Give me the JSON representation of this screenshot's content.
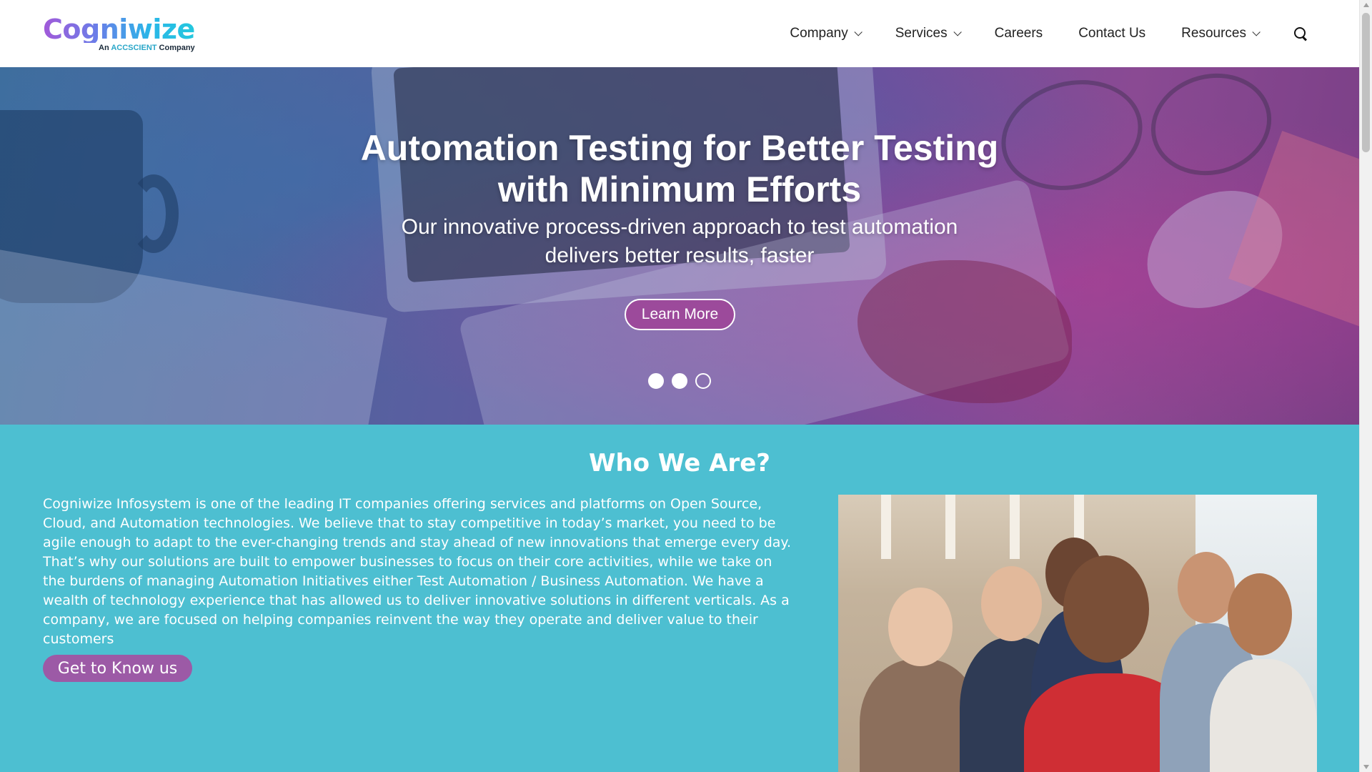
{
  "header": {
    "logo_text": "Cogniwize",
    "logo_tag_prefix": "An ",
    "logo_tag_brand": "ACCSCIENT",
    "logo_tag_suffix": " Company",
    "nav": [
      {
        "label": "Company",
        "dropdown": true
      },
      {
        "label": "Services",
        "dropdown": true
      },
      {
        "label": "Careers",
        "dropdown": false
      },
      {
        "label": "Contact Us",
        "dropdown": false
      },
      {
        "label": "Resources",
        "dropdown": true
      }
    ],
    "search_icon": "search-icon"
  },
  "hero": {
    "title_line1": "Automation Testing for Better Testing",
    "title_line2": "with Minimum Efforts",
    "subtitle_line1": "Our innovative process-driven approach to test automation",
    "subtitle_line2": "delivers better results, faster",
    "cta_label": "Learn More",
    "slides": [
      {
        "active": true
      },
      {
        "active": true
      },
      {
        "active": false
      }
    ]
  },
  "who": {
    "title": "Who We Are?",
    "body": "Cogniwize Infosystem is one of the leading IT companies offering services and platforms on Open Source, Cloud, and Automation technologies. We believe that to stay competitive in today’s market, you need to be agile enough to adapt to the ever-changing trends and stay ahead of new innovations that emerge every day. That’s why our solutions are built to empower businesses to focus on their core activities, while we take on the burdens of managing Automation Initiatives either Test Automation / Business Automation. We have a wealth of technology experience that has allowed us to deliver innovative solutions in different verticals. As a company, we are focused on helping companies reinvent the way they operate and deliver value to their customers",
    "cta_label": "Get to Know us"
  },
  "colors": {
    "teal_section": "#4dbfd1",
    "purple_button": "#9c4a9b",
    "purple_button_2": "#9c5aa6"
  }
}
